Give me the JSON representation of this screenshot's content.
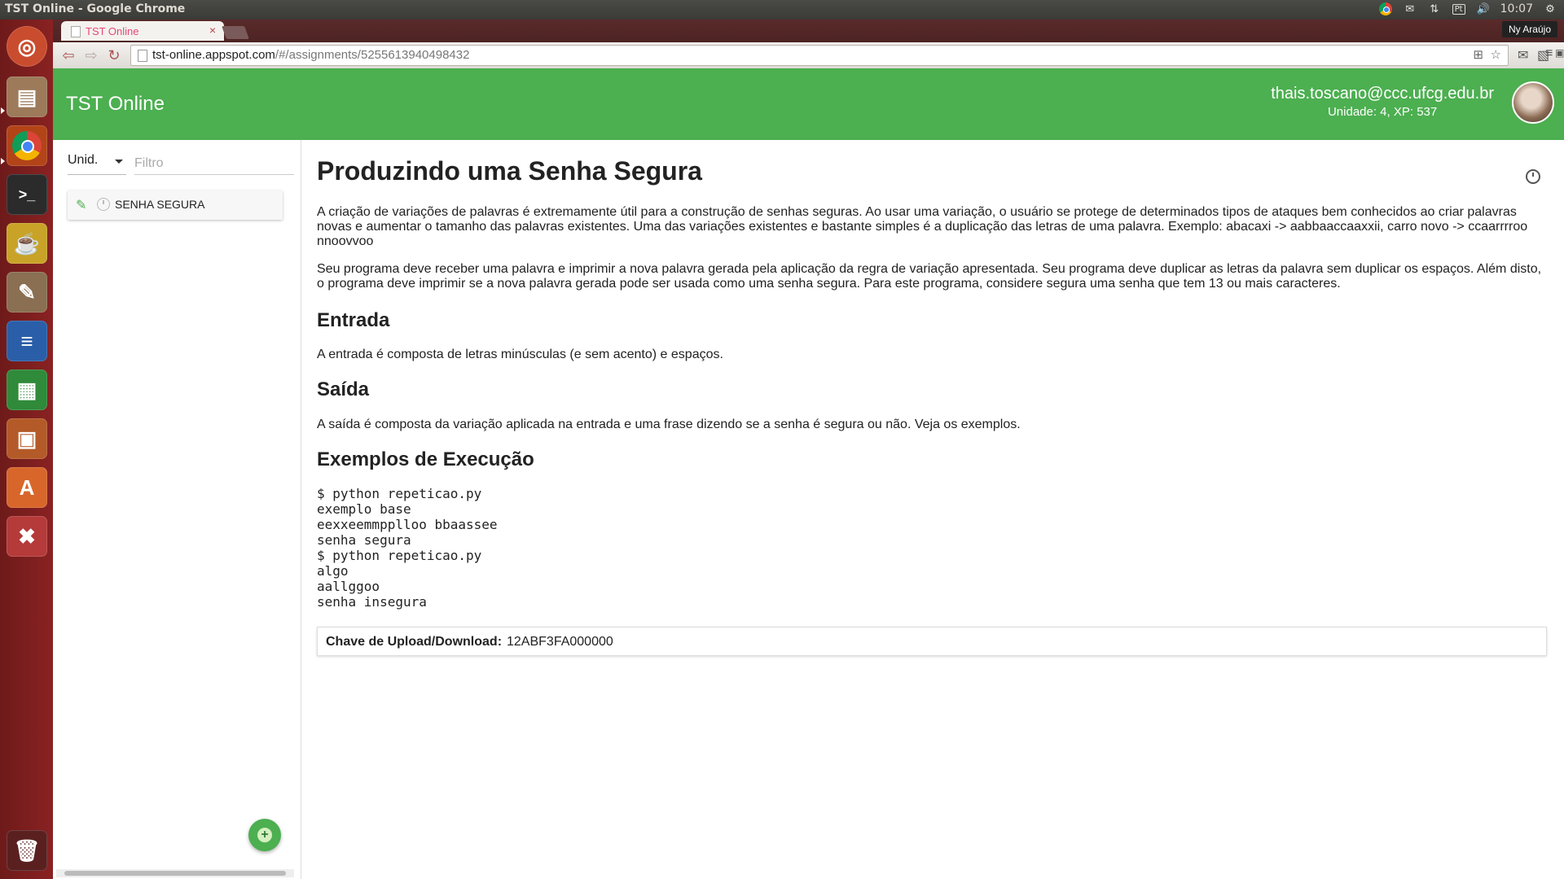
{
  "os": {
    "window_title": "TST Online - Google Chrome",
    "keyboard_layout": "Pt",
    "clock": "10:07",
    "user": "Ny Araújo"
  },
  "launcher": {
    "items": [
      "ubuntu-icon",
      "files-icon",
      "chrome-icon",
      "terminal-icon",
      "ticket-icon",
      "text-editor-icon",
      "writer-icon",
      "calc-icon",
      "impress-icon",
      "software-center-icon",
      "settings-icon",
      "trash-icon"
    ]
  },
  "browser": {
    "tab_title": "TST Online",
    "url_host": "tst-online.appspot.com",
    "url_path": "/#/assignments/5255613940498432"
  },
  "header": {
    "title": "TST Online",
    "user_email": "thais.toscano@ccc.ufcg.edu.br",
    "user_stats": "Unidade: 4, XP: 537",
    "color": "#4caf50"
  },
  "sidebar": {
    "unit_select": "Unid.",
    "filter_placeholder": "Filtro",
    "assignments": [
      {
        "label": "SENHA SEGURA"
      }
    ]
  },
  "main": {
    "title": "Produzindo uma Senha Segura",
    "intro_1": "A criação de variações de palavras é extremamente útil para a construção de senhas seguras. Ao usar uma variação, o usuário se protege de determinados tipos de ataques bem conhecidos ao criar palavras novas e aumentar o tamanho das palavras existentes. Uma das variações existentes e bastante simples é a duplicação das letras de uma palavra. Exemplo: abacaxi -> aabbaaccaaxxii, carro novo -> ccaarrrroo nnoovvoo",
    "intro_2": "Seu programa deve receber uma palavra e imprimir a nova palavra gerada pela aplicação da regra de variação apresentada. Seu programa deve duplicar as letras da palavra sem duplicar os espaços. Além disto, o programa deve imprimir se a nova palavra gerada pode ser usada como uma senha segura. Para este programa, considere segura uma senha que tem 13 ou mais caracteres.",
    "input_heading": "Entrada",
    "input_text": "A entrada é composta de letras minúsculas (e sem acento) e espaços.",
    "output_heading": "Saída",
    "output_text": "A saída é composta da variação aplicada na entrada e uma frase dizendo se a senha é segura ou não. Veja os exemplos.",
    "examples_heading": "Exemplos de Execução",
    "examples": "$ python repeticao.py\nexemplo base\neexxeemmpplloo bbaassee\nsenha segura\n$ python repeticao.py\nalgo\naallggoo\nsenha insegura",
    "upload_key_label": "Chave de Upload/Download:",
    "upload_key_value": "12ABF3FA000000"
  }
}
